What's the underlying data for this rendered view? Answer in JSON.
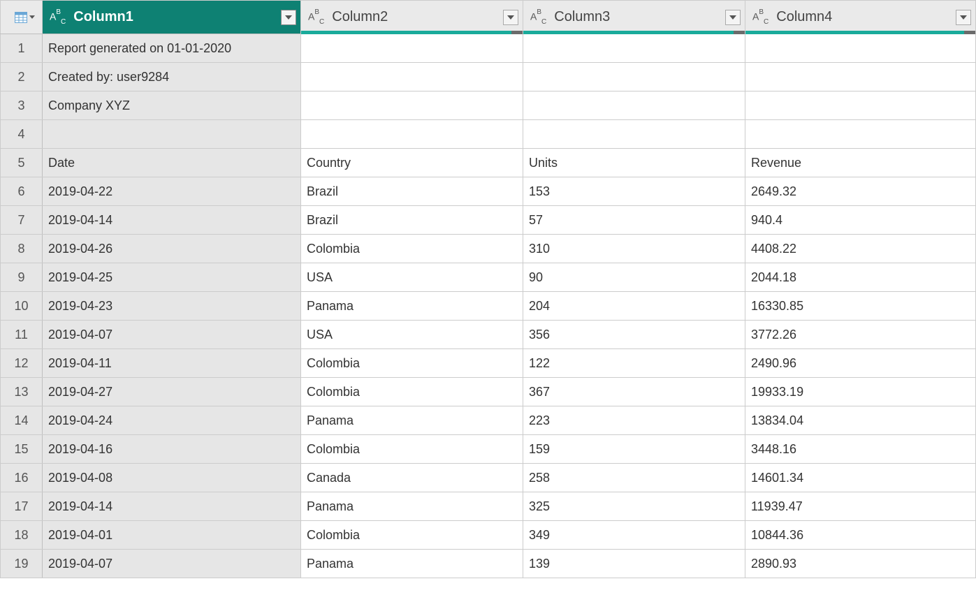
{
  "columns": [
    {
      "label": "Column1",
      "type": "ABC"
    },
    {
      "label": "Column2",
      "type": "ABC"
    },
    {
      "label": "Column3",
      "type": "ABC"
    },
    {
      "label": "Column4",
      "type": "ABC"
    }
  ],
  "rows": [
    {
      "n": "1",
      "c1": "Report generated on 01-01-2020",
      "c2": "",
      "c3": "",
      "c4": ""
    },
    {
      "n": "2",
      "c1": "Created by: user9284",
      "c2": "",
      "c3": "",
      "c4": ""
    },
    {
      "n": "3",
      "c1": "Company XYZ",
      "c2": "",
      "c3": "",
      "c4": ""
    },
    {
      "n": "4",
      "c1": "",
      "c2": "",
      "c3": "",
      "c4": ""
    },
    {
      "n": "5",
      "c1": "Date",
      "c2": "Country",
      "c3": "Units",
      "c4": "Revenue"
    },
    {
      "n": "6",
      "c1": "2019-04-22",
      "c2": "Brazil",
      "c3": "153",
      "c4": "2649.32"
    },
    {
      "n": "7",
      "c1": "2019-04-14",
      "c2": "Brazil",
      "c3": "57",
      "c4": "940.4"
    },
    {
      "n": "8",
      "c1": "2019-04-26",
      "c2": "Colombia",
      "c3": "310",
      "c4": "4408.22"
    },
    {
      "n": "9",
      "c1": "2019-04-25",
      "c2": "USA",
      "c3": "90",
      "c4": "2044.18"
    },
    {
      "n": "10",
      "c1": "2019-04-23",
      "c2": "Panama",
      "c3": "204",
      "c4": "16330.85"
    },
    {
      "n": "11",
      "c1": "2019-04-07",
      "c2": "USA",
      "c3": "356",
      "c4": "3772.26"
    },
    {
      "n": "12",
      "c1": "2019-04-11",
      "c2": "Colombia",
      "c3": "122",
      "c4": "2490.96"
    },
    {
      "n": "13",
      "c1": "2019-04-27",
      "c2": "Colombia",
      "c3": "367",
      "c4": "19933.19"
    },
    {
      "n": "14",
      "c1": "2019-04-24",
      "c2": "Panama",
      "c3": "223",
      "c4": "13834.04"
    },
    {
      "n": "15",
      "c1": "2019-04-16",
      "c2": "Colombia",
      "c3": "159",
      "c4": "3448.16"
    },
    {
      "n": "16",
      "c1": "2019-04-08",
      "c2": "Canada",
      "c3": "258",
      "c4": "14601.34"
    },
    {
      "n": "17",
      "c1": "2019-04-14",
      "c2": "Panama",
      "c3": "325",
      "c4": "11939.47"
    },
    {
      "n": "18",
      "c1": "2019-04-01",
      "c2": "Colombia",
      "c3": "349",
      "c4": "10844.36"
    },
    {
      "n": "19",
      "c1": "2019-04-07",
      "c2": "Panama",
      "c3": "139",
      "c4": "2890.93"
    }
  ]
}
